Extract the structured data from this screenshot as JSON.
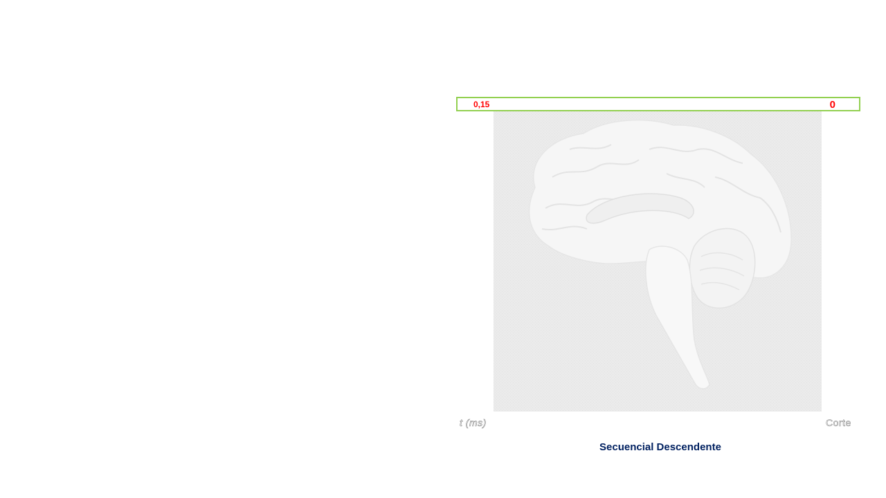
{
  "scale": {
    "left_value": "0,15",
    "right_value": "0",
    "border_color": "#92d050",
    "text_color": "#ff0000"
  },
  "axis": {
    "left_label": "t (ms)",
    "right_label": "Corte"
  },
  "caption": "Secuencial Descendente",
  "colors": {
    "caption": "#002060",
    "panel": "#ebebeb",
    "brain": "#f7f7f7"
  }
}
